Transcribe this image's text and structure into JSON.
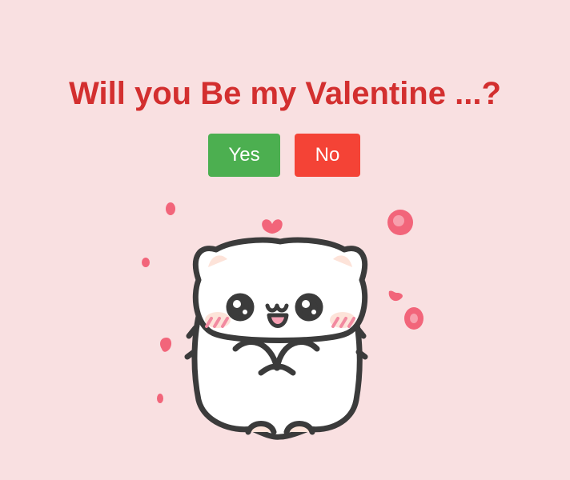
{
  "question": "Will you Be my Valentine ...?",
  "buttons": {
    "yes_label": "Yes",
    "no_label": "No"
  },
  "illustration": {
    "icon": "cute-cat-with-hearts",
    "heart_color": "#f2657a"
  },
  "colors": {
    "background": "#f9e0e1",
    "title": "#d32f2f",
    "yes": "#4caf50",
    "no": "#f44336"
  }
}
